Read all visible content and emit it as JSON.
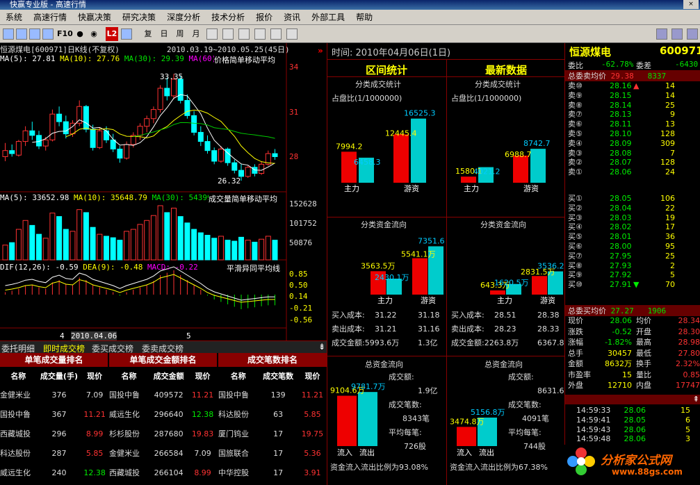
{
  "app": {
    "title": "快赢专业版 - 高速行情"
  },
  "menu": [
    "系统",
    "高速行情",
    "快嬴决策",
    "研究决策",
    "深度分析",
    "技术分析",
    "报价",
    "资讯",
    "外部工具",
    "帮助"
  ],
  "toolbar": {
    "f10": "F10",
    "fu": "复",
    "ri": "日",
    "zhou": "周",
    "yue": "月",
    "l2": "L2"
  },
  "kline": {
    "stock": "恒源煤电",
    "code": "[600971]",
    "period": "日K线",
    "fq": "(不复权)",
    "range": "2010.03.19~2010.05.25(45日)",
    "ma5": "MA(5): 27.81",
    "ma10": "MA(10): 27.76",
    "ma30": "MA(30): 29.39",
    "ma60": "MA(60):",
    "ma_title": "价格简单移动平均",
    "high_label": "33.35",
    "low_label": "26.32",
    "y_labels": [
      "34",
      "31",
      "28"
    ],
    "candles": [
      [
        27.9,
        28.8,
        27.6,
        28.3
      ],
      [
        28.3,
        28.7,
        27.9,
        28.1
      ],
      [
        28.0,
        29.0,
        27.9,
        28.9
      ],
      [
        28.9,
        29.9,
        28.6,
        29.6
      ],
      [
        29.6,
        30.2,
        29.0,
        29.3
      ],
      [
        29.3,
        29.6,
        28.4,
        28.6
      ],
      [
        28.6,
        29.2,
        28.3,
        29.0
      ],
      [
        29.0,
        31.0,
        28.9,
        30.7
      ],
      [
        30.7,
        31.2,
        29.9,
        30.2
      ],
      [
        30.2,
        30.6,
        29.1,
        29.4
      ],
      [
        29.4,
        30.3,
        29.2,
        30.1
      ],
      [
        30.1,
        31.6,
        29.9,
        31.2
      ],
      [
        31.2,
        31.3,
        29.5,
        29.7
      ],
      [
        29.7,
        30.0,
        28.3,
        28.5
      ],
      [
        28.5,
        29.8,
        28.4,
        29.6
      ],
      [
        29.6,
        29.9,
        28.8,
        29.0
      ],
      [
        29.0,
        29.4,
        28.2,
        28.4
      ],
      [
        28.4,
        28.6,
        27.5,
        27.8
      ],
      [
        27.8,
        28.9,
        27.7,
        28.7
      ],
      [
        28.7,
        29.5,
        28.5,
        29.3
      ],
      [
        29.3,
        30.1,
        29.0,
        29.9
      ],
      [
        29.9,
        30.6,
        29.5,
        30.4
      ],
      [
        30.4,
        31.2,
        30.1,
        31.0
      ],
      [
        31.0,
        32.6,
        30.8,
        32.4
      ],
      [
        32.4,
        33.1,
        31.6,
        31.9
      ],
      [
        31.9,
        33.35,
        31.7,
        33.0
      ],
      [
        33.0,
        33.2,
        31.4,
        31.6
      ],
      [
        31.6,
        32.0,
        30.4,
        30.6
      ],
      [
        30.6,
        30.9,
        29.3,
        29.5
      ],
      [
        29.5,
        29.9,
        28.6,
        28.9
      ],
      [
        28.9,
        29.3,
        28.1,
        28.3
      ],
      [
        28.3,
        28.5,
        27.4,
        27.6
      ],
      [
        27.6,
        28.6,
        27.5,
        28.4
      ],
      [
        28.4,
        28.5,
        27.3,
        27.5
      ],
      [
        27.5,
        27.7,
        26.8,
        27.0
      ],
      [
        27.0,
        27.4,
        26.32,
        26.6
      ],
      [
        26.6,
        27.3,
        26.5,
        27.2
      ],
      [
        27.2,
        27.4,
        26.6,
        26.8
      ],
      [
        26.8,
        27.6,
        26.7,
        27.4
      ],
      [
        27.4,
        28.3,
        27.3,
        28.1
      ],
      [
        28.1,
        28.4,
        27.7,
        27.9
      ]
    ],
    "vol": {
      "ma5": "MA(5): 33652.98",
      "ma10": "MA(10): 35648.79",
      "ma30": "MA(30): 54399.04",
      "title": "成交量简单移动平均",
      "y_labels": [
        "152628",
        "101752",
        "50876"
      ],
      "values": [
        30,
        35,
        62,
        80,
        70,
        52,
        44,
        95,
        88,
        62,
        58,
        102,
        96,
        66,
        52,
        48,
        45,
        40,
        58,
        62,
        72,
        80,
        90,
        110,
        96,
        105,
        88,
        75,
        62,
        55,
        50,
        44,
        48,
        40,
        38,
        46,
        40,
        36,
        42,
        48,
        40
      ]
    },
    "macd": {
      "dif": "DIF(12,26): -0.59",
      "dea": "DEA(9): -0.48",
      "macd": "MACD: -0.22",
      "title": "平滑异同平均线",
      "y_labels": [
        "0.85",
        "0.50",
        "0.14",
        "-0.21",
        "-0.56"
      ],
      "values": [
        0.05,
        0.08,
        0.12,
        0.18,
        0.2,
        0.15,
        0.12,
        0.25,
        0.3,
        0.22,
        0.2,
        0.35,
        0.3,
        0.2,
        0.15,
        0.1,
        0.05,
        -0.02,
        0.05,
        0.1,
        0.15,
        0.2,
        0.28,
        0.4,
        0.45,
        0.5,
        0.4,
        0.3,
        0.2,
        0.1,
        -0.02,
        -0.1,
        -0.15,
        -0.2,
        -0.25,
        -0.3,
        -0.28,
        -0.26,
        -0.24,
        -0.22,
        -0.22
      ]
    },
    "date_axis": {
      "d1": "4",
      "d2": "2010.04.06",
      "d3": "5"
    }
  },
  "bottom_tabs": [
    "委托明细",
    "即时成交榜",
    "委买成交榜",
    "委卖成交榜"
  ],
  "rank": {
    "t1": "单笔成交量排名",
    "t2": "单笔成交金额排名",
    "t3": "成交笔数排名",
    "h1": [
      "名称",
      "成交量(手)",
      "现价"
    ],
    "h2": [
      "名称",
      "成交金额",
      "现价"
    ],
    "h3": [
      "名称",
      "成交笔数",
      "现价"
    ],
    "r1": [
      [
        "金健米业",
        "376",
        "7.09"
      ],
      [
        "国投中鲁",
        "367",
        "11.21"
      ],
      [
        "西藏城投",
        "296",
        "8.99"
      ],
      [
        "科达股份",
        "287",
        "5.85"
      ],
      [
        "威远生化",
        "240",
        "12.38"
      ]
    ],
    "r2": [
      [
        "国投中鲁",
        "409572",
        "11.21"
      ],
      [
        "威远生化",
        "296640",
        "12.38"
      ],
      [
        "杉杉股份",
        "287680",
        "19.83"
      ],
      [
        "金健米业",
        "266584",
        "7.09"
      ],
      [
        "西藏城投",
        "266104",
        "8.99"
      ]
    ],
    "r3": [
      [
        "国投中鲁",
        "139",
        "11.21"
      ],
      [
        "科达股份",
        "63",
        "5.85"
      ],
      [
        "厦门钨业",
        "17",
        "19.75"
      ],
      [
        "国旅联合",
        "17",
        "5.36"
      ],
      [
        "中华控股",
        "17",
        "3.91"
      ]
    ]
  },
  "center": {
    "time_label": "时间: 2010年04月06日(1日)",
    "left_title": "区间统计",
    "right_title": "最新数据",
    "cls_vol": "分类成交统计",
    "ratio": "占盘比(1/1000000)",
    "cls_fund": "分类资金流向",
    "total_fund": "总资金流向",
    "lv": {
      "zhuli_a": "7994.2",
      "zhuli_b": "6458.3",
      "youzi_a": "12445.4",
      "youzi_b": "16525.3"
    },
    "rv": {
      "zhuli_a": "1580.1",
      "zhuli_b": "4021.2",
      "youzi_a": "6988.7",
      "youzi_b": "8742.7"
    },
    "lf": {
      "zhuli_a": "3563.5万",
      "zhuli_b": "2430.1万",
      "youzi_a": "5541.1万",
      "youzi_b": "7351.6"
    },
    "rf": {
      "zhuli_a": "643.3万",
      "zhuli_b": "1620.5万",
      "youzi_a": "2831.5万",
      "youzi_b": "3536.2"
    },
    "zhuli": "主力",
    "youzi": "游资",
    "cost_l": [
      [
        "买入成本:",
        "31.22",
        "31.18"
      ],
      [
        "卖出成本:",
        "31.21",
        "31.16"
      ],
      [
        "成交金额:5993.6万",
        "",
        "1.3亿"
      ]
    ],
    "cost_r": [
      [
        "买入成本:",
        "28.51",
        "28.38"
      ],
      [
        "卖出成本:",
        "28.23",
        "28.33"
      ],
      [
        "成交金额:2263.8万",
        "",
        "6367.8万"
      ]
    ],
    "tl": {
      "a": "9104.6万",
      "b": "9781.7万",
      "amount_lbl": "成交额:",
      "amount": "1.9亿",
      "count_lbl": "成交笔数:",
      "count": "8343笔",
      "avg_lbl": "平均每笔:",
      "avg": "726股",
      "ratio": "资金流入流出比例为93.08%"
    },
    "tr": {
      "a": "3474.8万",
      "b": "5156.8万",
      "amount_lbl": "成交额:",
      "amount": "8631.6万",
      "count_lbl": "成交笔数:",
      "count": "4091笔",
      "avg_lbl": "平均每笔:",
      "avg": "744股",
      "ratio": "资金流入流出比例为67.38%"
    },
    "inflow": "流入",
    "outflow": "流出"
  },
  "quote": {
    "name": "恒源煤电",
    "code": "600971",
    "wb_lbl": "委比",
    "wb": "-62.78%",
    "wc_lbl": "委差",
    "wc": "-6430",
    "sell_avg_lbl": "总委卖均价",
    "sell_avg": "29.38",
    "sell_vol": "8337",
    "sells": [
      [
        "卖⑩",
        "28.16",
        "▲",
        "14"
      ],
      [
        "卖⑨",
        "28.15",
        "",
        "14"
      ],
      [
        "卖⑧",
        "28.14",
        "",
        "25"
      ],
      [
        "卖⑦",
        "28.13",
        "",
        "9"
      ],
      [
        "卖⑥",
        "28.11",
        "",
        "13"
      ],
      [
        "卖⑤",
        "28.10",
        "",
        "128"
      ],
      [
        "卖④",
        "28.09",
        "",
        "309"
      ],
      [
        "卖③",
        "28.08",
        "",
        "7"
      ],
      [
        "卖②",
        "28.07",
        "",
        "128"
      ],
      [
        "卖①",
        "28.06",
        "",
        "24"
      ]
    ],
    "buys": [
      [
        "买①",
        "28.05",
        "",
        "106"
      ],
      [
        "买②",
        "28.04",
        "",
        "22"
      ],
      [
        "买③",
        "28.03",
        "",
        "19"
      ],
      [
        "买④",
        "28.02",
        "",
        "17"
      ],
      [
        "买⑤",
        "28.01",
        "",
        "36"
      ],
      [
        "买⑥",
        "28.00",
        "",
        "95"
      ],
      [
        "买⑦",
        "27.95",
        "",
        "25"
      ],
      [
        "买⑧",
        "27.93",
        "",
        "2"
      ],
      [
        "买⑨",
        "27.92",
        "",
        "5"
      ],
      [
        "买⑩",
        "27.91",
        "▼",
        "70"
      ]
    ],
    "buy_avg_lbl": "总委买均价",
    "buy_avg": "27.27",
    "buy_vol": "1906",
    "stats": [
      [
        "现价",
        "28.06",
        "均价",
        "28.34"
      ],
      [
        "涨跌",
        "-0.52",
        "开盘",
        "28.30"
      ],
      [
        "涨幅",
        "-1.82%",
        "最高",
        "28.98"
      ],
      [
        "总手",
        "30457",
        "最低",
        "27.80"
      ],
      [
        "金额",
        "8632万",
        "换手",
        "2.32%"
      ],
      [
        "市盈率",
        "15",
        "量比",
        "0.85"
      ],
      [
        "外盘",
        "12710",
        "内盘",
        "17747"
      ]
    ],
    "ticks": [
      [
        "14:59:33",
        "28.06",
        "15"
      ],
      [
        "14:59:41",
        "28.05",
        "6"
      ],
      [
        "14:59:43",
        "28.06",
        "5"
      ],
      [
        "14:59:48",
        "28.06",
        "3"
      ]
    ]
  },
  "watermark": {
    "name": "分析家公式网",
    "url": "www.88gs.com"
  }
}
